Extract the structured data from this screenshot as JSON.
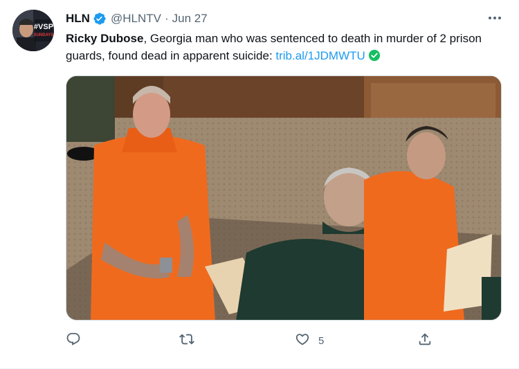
{
  "tweet": {
    "author_name": "HLN",
    "author_handle": "@HLNTV",
    "separator": "·",
    "date": "Jun 27",
    "text_bold": "Ricky Dubose",
    "text_rest": ", Georgia man who was sentenced to death in murder of 2 prison guards, found dead in apparent suicide: ",
    "link_text": "trib.al/1JDMWTU",
    "avatar_text": {
      "line1": "#VSP",
      "line2": "SUNDAYS"
    },
    "like_count": "5"
  },
  "icons": {
    "verified": "verified-badge-icon",
    "more": "more-options-icon",
    "reply": "reply-icon",
    "retweet": "retweet-icon",
    "like": "heart-icon",
    "share": "share-icon",
    "link_check": "check-circle-icon"
  },
  "colors": {
    "accent": "#1d9bf0",
    "secondary_text": "#536471",
    "link_check": "#17bf63"
  }
}
